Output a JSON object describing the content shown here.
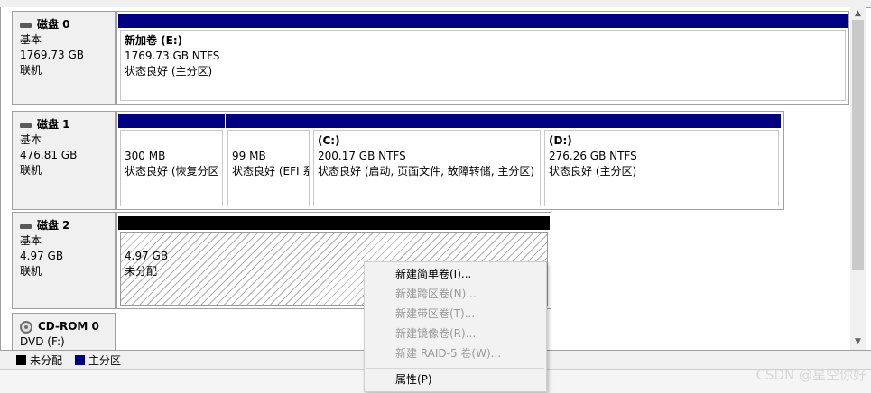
{
  "disks": [
    {
      "name": "磁盘 0",
      "type": "基本",
      "size": "1769.73 GB",
      "status": "联机",
      "partitions": [
        {
          "title": "新加卷  (E:)",
          "size": "1769.73 GB NTFS",
          "health": "状态良好 (主分区)"
        }
      ]
    },
    {
      "name": "磁盘 1",
      "type": "基本",
      "size": "476.81 GB",
      "status": "联机",
      "partitions": [
        {
          "title": "",
          "size": "300 MB",
          "health": "状态良好 (恢复分区"
        },
        {
          "title": "",
          "size": "99 MB",
          "health": "状态良好 (EFI 系"
        },
        {
          "title": "(C:)",
          "size": "200.17 GB NTFS",
          "health": "状态良好 (启动, 页面文件, 故障转储, 主分区)"
        },
        {
          "title": "(D:)",
          "size": "276.26 GB NTFS",
          "health": "状态良好 (主分区)"
        }
      ]
    },
    {
      "name": "磁盘 2",
      "type": "基本",
      "size": "4.97 GB",
      "status": "联机",
      "partitions": [
        {
          "title": "",
          "size": "4.97 GB",
          "health": "未分配"
        }
      ]
    },
    {
      "name": "CD-ROM 0",
      "type": "DVD (F:)"
    }
  ],
  "legend": [
    {
      "label": "未分配",
      "color": "#000000"
    },
    {
      "label": "主分区",
      "color": "#000080"
    }
  ],
  "context_menu": [
    {
      "label": "新建简单卷(I)...",
      "enabled": true
    },
    {
      "label": "新建跨区卷(N)...",
      "enabled": false
    },
    {
      "label": "新建带区卷(T)...",
      "enabled": false
    },
    {
      "label": "新建镜像卷(R)...",
      "enabled": false
    },
    {
      "label": "新建 RAID-5 卷(W)...",
      "enabled": false
    },
    {
      "label": "属性(P)",
      "enabled": true
    }
  ],
  "watermark": "CSDN @星空你好"
}
